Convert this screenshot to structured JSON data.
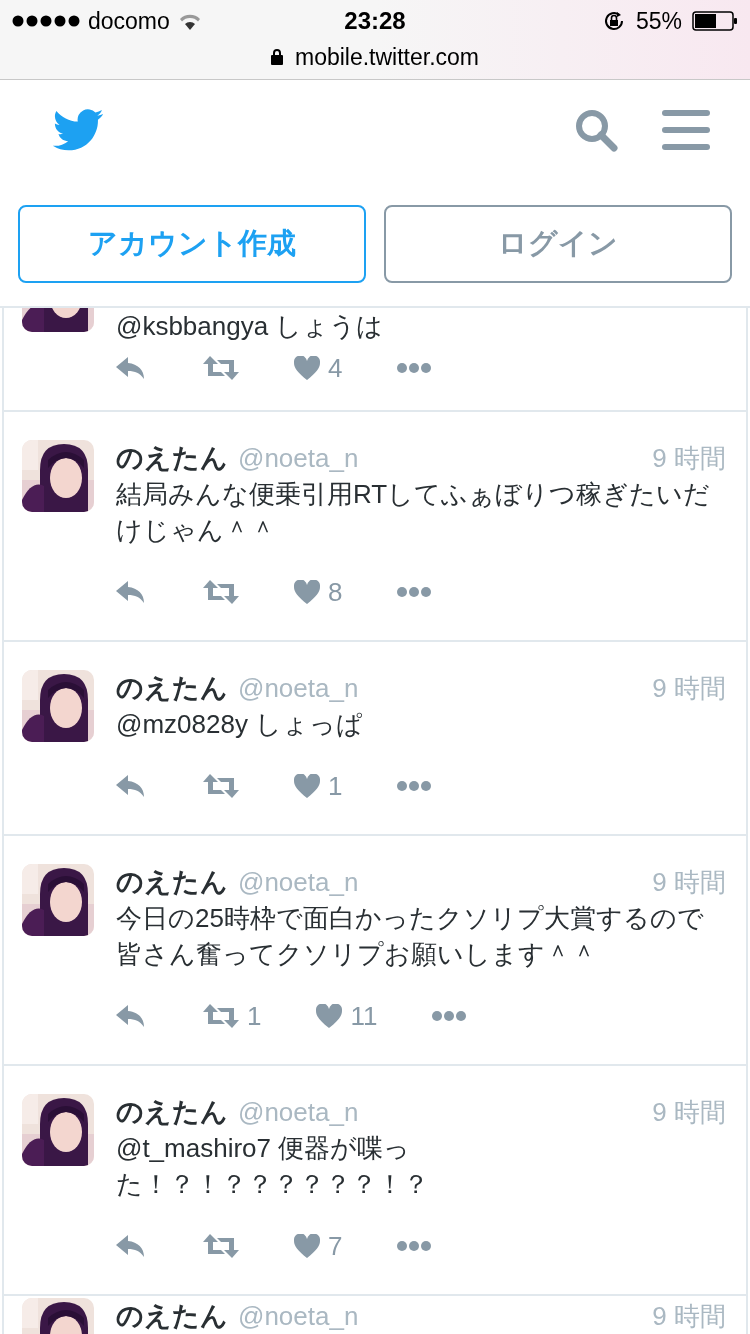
{
  "status_bar": {
    "carrier": "docomo",
    "time": "23:28",
    "battery": "55%"
  },
  "address_bar": {
    "url": "mobile.twitter.com"
  },
  "header": {
    "buttons": [
      {
        "label": "アカウント作成",
        "kind": "primary"
      },
      {
        "label": "ログイン",
        "kind": "secondary"
      }
    ]
  },
  "tweets": [
    {
      "kind": "partial_top",
      "text": "@ksbbangya しょうは",
      "likes": "4"
    },
    {
      "kind": "full",
      "name": "のえたん",
      "handle": "@noeta_n",
      "time": "9 時間",
      "text": "結局みんな便乗引用RTしてふぁぼりつ稼ぎたいだけじゃん＾＾",
      "likes": "8"
    },
    {
      "kind": "full",
      "name": "のえたん",
      "handle": "@noeta_n",
      "time": "9 時間",
      "text": "@mz0828y しょっぱ",
      "likes": "1"
    },
    {
      "kind": "full",
      "name": "のえたん",
      "handle": "@noeta_n",
      "time": "9 時間",
      "text": "今日の25時枠で面白かったクソリプ大賞するので皆さん奮ってクソリプお願いします＾＾",
      "retweets": "1",
      "likes": "11"
    },
    {
      "kind": "full",
      "name": "のえたん",
      "handle": "@noeta_n",
      "time": "9 時間",
      "text": "@t_mashiro7 便器が喋った！？！？？？？？？！？",
      "likes": "7"
    },
    {
      "kind": "partial_bottom",
      "name": "のえたん",
      "handle": "@noeta_n",
      "time": "9 時間"
    }
  ]
}
